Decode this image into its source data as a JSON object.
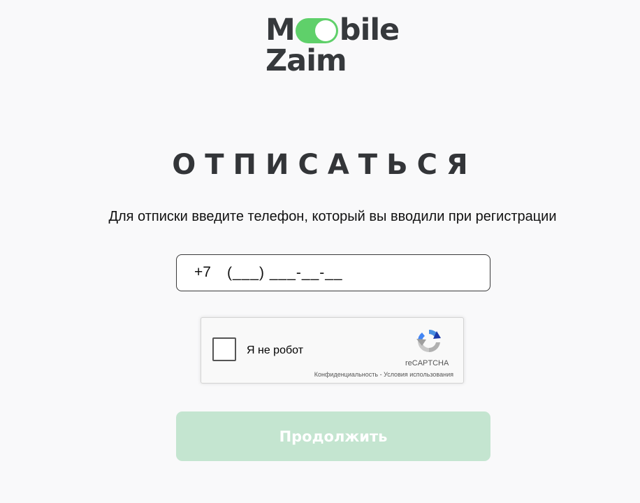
{
  "logo": {
    "line1_start": "M",
    "line1_end": "bile",
    "line2": "Zaim",
    "brand_color": "#5fd06a"
  },
  "title": "ОТПИСАТЬСЯ",
  "subtitle": "Для отписки введите телефон, который вы вводили при регистрации",
  "phone": {
    "prefix": "+7",
    "placeholder": "(___) ___-__-__",
    "value": ""
  },
  "recaptcha": {
    "label": "Я не робот",
    "brand": "reCAPTCHA",
    "privacy_link": "Конфиденциальность",
    "separator": " - ",
    "terms_link": "Условия использования",
    "icon": "recaptcha-logo-icon"
  },
  "continue_button": {
    "label": "Продолжить",
    "color": "#c4e5d0"
  }
}
